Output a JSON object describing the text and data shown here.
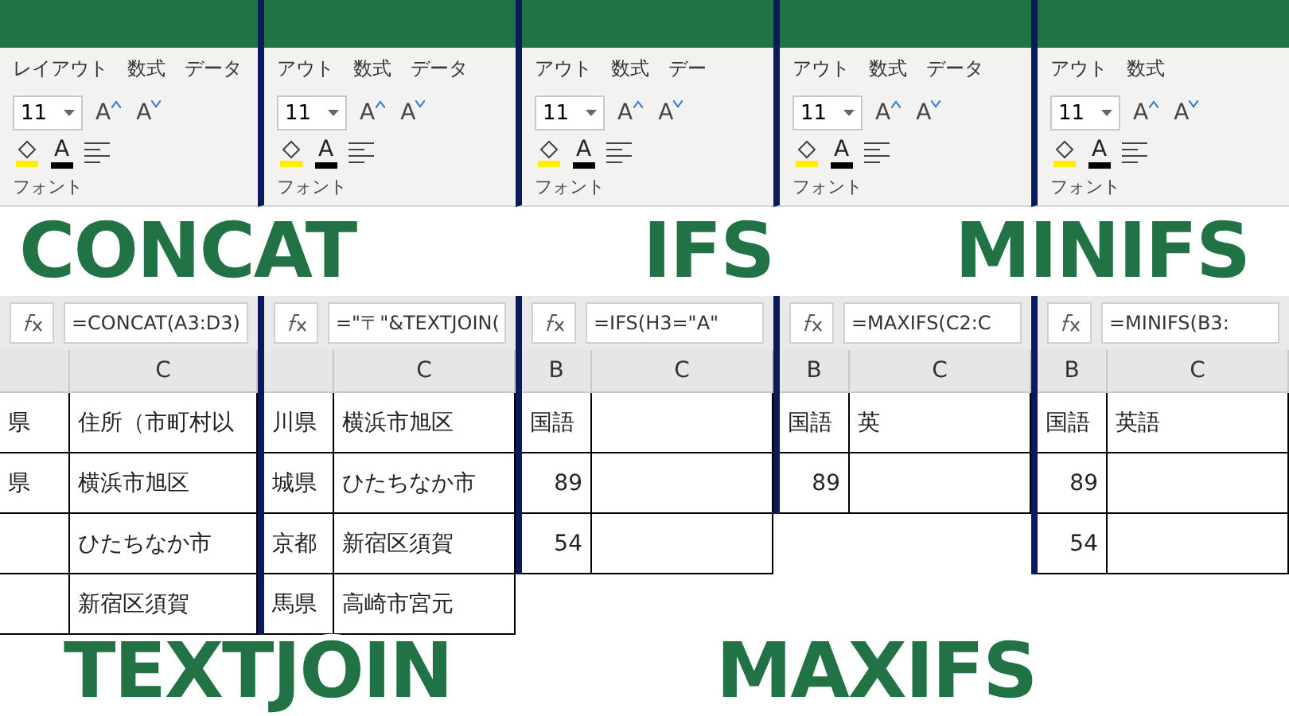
{
  "panels": [
    {
      "tabs": [
        "レイアウト",
        "数式",
        "データ"
      ],
      "ribbon": {
        "font_size": "11",
        "grow": "A",
        "shrink": "A",
        "font_color": "A",
        "group": "フォント"
      },
      "formula": "=CONCAT(A3:D3)",
      "columns": [
        "",
        "C"
      ],
      "rows": [
        [
          {
            "kind": "text",
            "text": "県"
          },
          {
            "kind": "text",
            "text": "住所（市町村以"
          }
        ],
        [
          {
            "kind": "text",
            "text": "県"
          },
          {
            "kind": "text",
            "text": "横浜市旭区"
          }
        ],
        [
          {
            "kind": "blank"
          },
          {
            "kind": "text",
            "text": "ひたちなか市"
          }
        ],
        [
          {
            "kind": "blank"
          },
          {
            "kind": "text",
            "text": "新宿区須賀"
          }
        ]
      ]
    },
    {
      "tabs": [
        "アウト",
        "数式",
        "データ"
      ],
      "ribbon": {
        "font_size": "11",
        "grow": "A",
        "shrink": "A",
        "font_color": "A",
        "group": "フォント"
      },
      "formula": "=\"〒\"&TEXTJOIN(",
      "columns": [
        "",
        "C"
      ],
      "rows": [
        [
          {
            "kind": "text",
            "text": "川県"
          },
          {
            "kind": "text",
            "text": "横浜市旭区"
          }
        ],
        [
          {
            "kind": "text",
            "text": "城県"
          },
          {
            "kind": "text",
            "text": "ひたちなか市"
          }
        ],
        [
          {
            "kind": "text",
            "text": "京都"
          },
          {
            "kind": "text",
            "text": "新宿区須賀"
          }
        ],
        [
          {
            "kind": "text",
            "text": "馬県"
          },
          {
            "kind": "text",
            "text": "高崎市宮元"
          }
        ]
      ]
    },
    {
      "tabs": [
        "アウト",
        "数式",
        "デー"
      ],
      "ribbon": {
        "font_size": "11",
        "grow": "A",
        "shrink": "A",
        "font_color": "A",
        "group": "フォント"
      },
      "formula": "=IFS(H3=\"A\"",
      "columns": [
        "B",
        "C"
      ],
      "rows": [
        [
          {
            "kind": "text",
            "text": "国語"
          },
          {
            "kind": "blank"
          }
        ],
        [
          {
            "kind": "number",
            "text": "89"
          },
          {
            "kind": "blank"
          }
        ],
        [
          {
            "kind": "number",
            "text": "54"
          },
          {
            "kind": "blank"
          }
        ]
      ]
    },
    {
      "tabs": [
        "アウト",
        "数式",
        "データ"
      ],
      "ribbon": {
        "font_size": "11",
        "grow": "A",
        "shrink": "A",
        "font_color": "A",
        "group": "フォント"
      },
      "formula": "=MAXIFS(C2:C",
      "columns": [
        "B",
        "C"
      ],
      "rows": [
        [
          {
            "kind": "text",
            "text": "国語"
          },
          {
            "kind": "text",
            "text": "英"
          }
        ],
        [
          {
            "kind": "number",
            "text": "89"
          },
          {
            "kind": "blank"
          }
        ]
      ]
    },
    {
      "tabs": [
        "アウト",
        "数式"
      ],
      "ribbon": {
        "font_size": "11",
        "grow": "A",
        "shrink": "A",
        "font_color": "A",
        "group": "フォント"
      },
      "formula": "=MINIFS(B3:",
      "columns": [
        "B",
        "C"
      ],
      "rows": [
        [
          {
            "kind": "text",
            "text": "国語"
          },
          {
            "kind": "text",
            "text": "英語"
          }
        ],
        [
          {
            "kind": "number",
            "text": "89"
          },
          {
            "kind": "blank"
          }
        ],
        [
          {
            "kind": "number",
            "text": "54"
          },
          {
            "kind": "blank"
          }
        ]
      ]
    }
  ],
  "titles": [
    "CONCAT",
    "TEXTJOIN",
    "IFS",
    "MAXIFS",
    "MINIFS"
  ]
}
